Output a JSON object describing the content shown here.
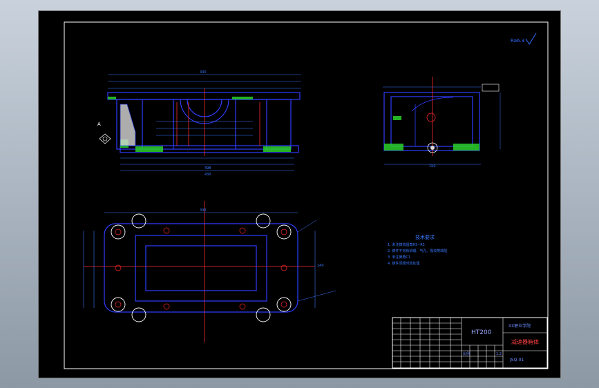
{
  "colors": {
    "background": "#000000",
    "frame": "#ffffff",
    "outline": "#2f3dff",
    "centerline": "#ff2a2a",
    "dimension": "#3a78ff",
    "hatch": "#2bd12b",
    "face": "#d9d9d9"
  },
  "roughness": {
    "label": "Ra6.3"
  },
  "notes": {
    "heading": "技术要求",
    "lines": [
      "1. 未注铸造圆角R3~R5",
      "2. 铸件不得有砂眼、气孔、裂纹等缺陷",
      "3. 未注倒角C1",
      "4. 铸件须经时效处理"
    ]
  },
  "title_block": {
    "material": "HT200",
    "school": "XX职业学院",
    "part_name": "减速器箱体",
    "drawing_no": "JSQ-01",
    "scale_label": "比例",
    "scale_value": "1:2"
  },
  "dimensions": {
    "front_overall": "430",
    "front_base": "398",
    "front_height": "150",
    "top_width": "240",
    "top_length": "398"
  }
}
